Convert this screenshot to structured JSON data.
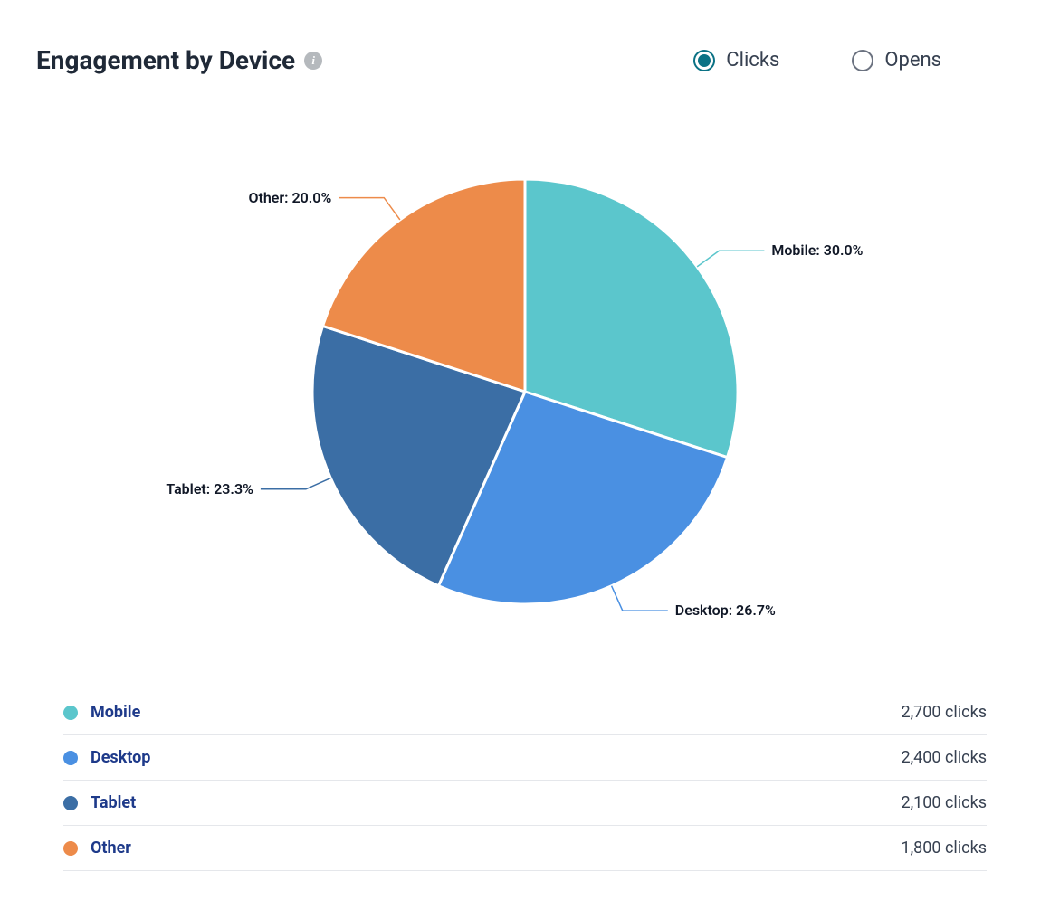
{
  "title": "Engagement by Device",
  "toggles": {
    "clicks": {
      "label": "Clicks",
      "selected": true
    },
    "opens": {
      "label": "Opens",
      "selected": false
    }
  },
  "chart_data": {
    "type": "pie",
    "title": "Engagement by Device",
    "series": [
      {
        "name": "Mobile",
        "value": 2700,
        "pct": 30.0,
        "color": "#5bc6cc",
        "clicks_label": "2,700 clicks",
        "slice_label": "Mobile: 30.0%"
      },
      {
        "name": "Desktop",
        "value": 2400,
        "pct": 26.7,
        "color": "#4a90e2",
        "clicks_label": "2,400 clicks",
        "slice_label": "Desktop: 26.7%"
      },
      {
        "name": "Tablet",
        "value": 2100,
        "pct": 23.3,
        "color": "#3b6ea5",
        "clicks_label": "2,100 clicks",
        "slice_label": "Tablet: 23.3%"
      },
      {
        "name": "Other",
        "value": 1800,
        "pct": 20.0,
        "color": "#ed8b4a",
        "clicks_label": "1,800 clicks",
        "slice_label": "Other: 20.0%"
      }
    ]
  }
}
